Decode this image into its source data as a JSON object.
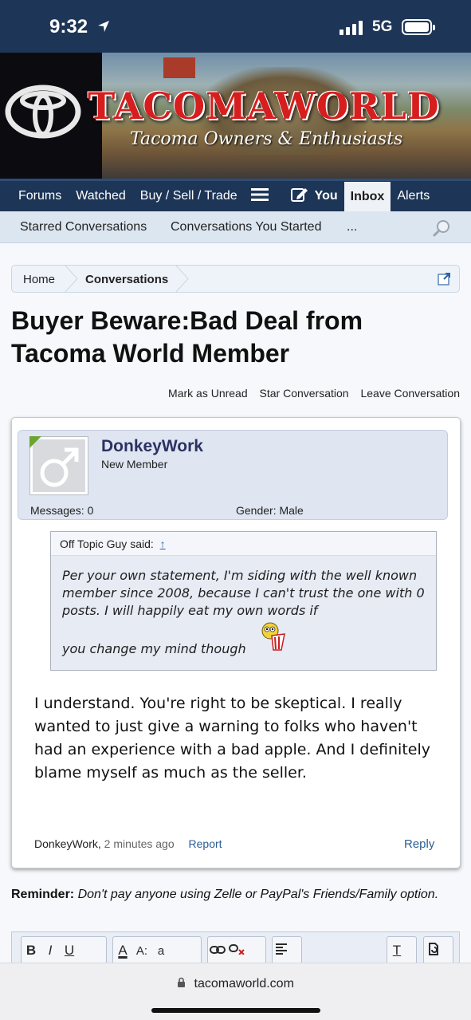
{
  "status": {
    "time": "9:32",
    "network": "5G"
  },
  "site": {
    "brand": "TACOMAWORLD",
    "tagline": "Tacoma Owners & Enthusiasts"
  },
  "nav": {
    "forums": "Forums",
    "watched": "Watched",
    "buy_sell": "Buy / Sell / Trade",
    "you": "You",
    "inbox": "Inbox",
    "alerts": "Alerts"
  },
  "subnav": {
    "starred": "Starred Conversations",
    "started": "Conversations You Started",
    "more": "..."
  },
  "breadcrumb": {
    "home": "Home",
    "current": "Conversations"
  },
  "conversation": {
    "title": "Buyer Beware:Bad Deal from Tacoma World Member",
    "actions": {
      "mark_unread": "Mark as Unread",
      "star": "Star Conversation",
      "leave": "Leave Conversation"
    }
  },
  "message": {
    "username": "DonkeyWork",
    "role": "New Member",
    "messages_label": "Messages: 0",
    "gender_label": "Gender: Male",
    "quote": {
      "author": "Off Topic Guy said:",
      "up_arrow": "↑",
      "text": "Per your own statement, I'm siding with the well known member since 2008, because I can't trust the one with 0 posts. I will happily eat my own words if",
      "last_line": "you change my mind though"
    },
    "body": "I understand. You're right to be skeptical. I really wanted to just give a warning to folks who haven't had an experience with a bad apple. And I definitely blame myself as much as the seller.",
    "author": "DonkeyWork,",
    "time": "2 minutes ago",
    "report": "Report",
    "reply": "Reply"
  },
  "reminder": {
    "label": "Reminder:",
    "text": "Don't pay anyone using Zelle or PayPal's Friends/Family option."
  },
  "toolbar": {
    "bold": "B",
    "italic": "I",
    "underline": "U",
    "font_color": "A",
    "font_size": "A:",
    "font_family": "a",
    "clear": "T"
  },
  "browser": {
    "url": "tacomaworld.com"
  },
  "colors": {
    "header": "#1d3556",
    "subnav": "#dce6f1",
    "link": "#2b5e94",
    "brand_red": "#d61e1e",
    "username": "#2a3262"
  }
}
